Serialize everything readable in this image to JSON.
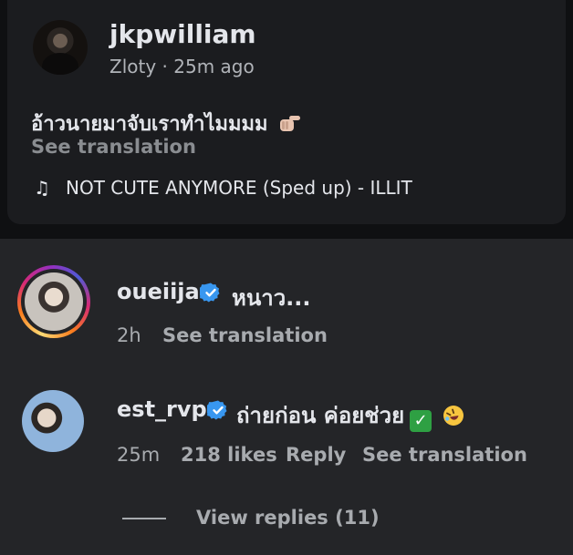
{
  "post": {
    "username": "jkpwilliam",
    "location": "Zloty",
    "separator": "·",
    "time": "25m ago",
    "caption": "อ้าวนายมาจับเราทำไมมมม",
    "caption_emoji": "pointing-hand-icon",
    "see_translation": "See translation",
    "music_icon": "♫",
    "music": "NOT CUTE ANYMORE (Sped up) - ILLIT"
  },
  "comments": [
    {
      "username": "oueiija",
      "verified": true,
      "has_story_ring": true,
      "text": "หนาว...",
      "time": "2h",
      "see_translation": "See translation"
    },
    {
      "username": "est_rvp",
      "verified": true,
      "has_story_ring": false,
      "text": "ถ่ายก่อน ค่อยช่วย",
      "emojis": [
        "check-mark-button-icon",
        "rolling-laughing-icon"
      ],
      "time": "25m",
      "likes": "218 likes",
      "reply": "Reply",
      "see_translation": "See translation",
      "view_replies": "View replies (11)"
    }
  ],
  "colors": {
    "background": "#0f1012",
    "card": "#1b1c1f",
    "panel": "#242528",
    "text": "#e4e6eb",
    "muted": "#a8abaf",
    "verified_blue": "#3897f0"
  }
}
